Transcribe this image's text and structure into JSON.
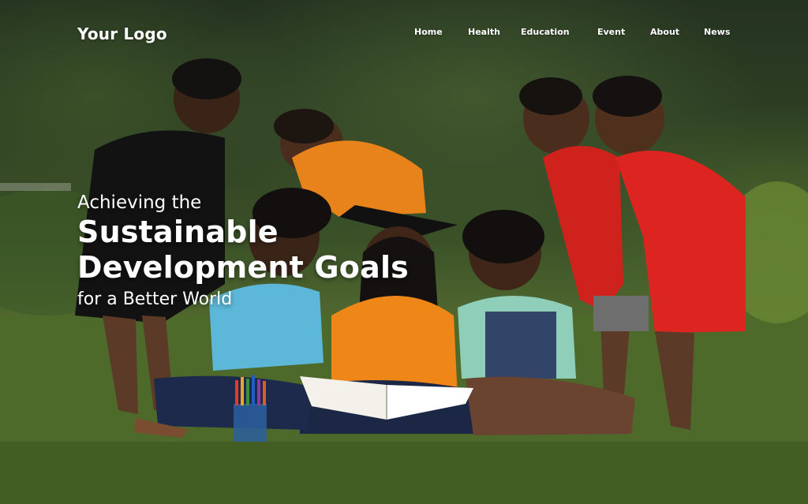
{
  "brand": {
    "logo_text": "Your Logo"
  },
  "nav": {
    "items": [
      {
        "label": "Home"
      },
      {
        "label": "Health"
      },
      {
        "label": "Education"
      },
      {
        "label": "Event"
      },
      {
        "label": "About"
      },
      {
        "label": "News"
      }
    ]
  },
  "hero": {
    "headline_pre": "Achieving the",
    "headline_line1": "Sustainable",
    "headline_line2": "Development Goals",
    "headline_post": "for a Better World",
    "image_description_icon": "children-reading-photo"
  },
  "colors": {
    "text": "#ffffff",
    "grass": "#4f6a2b",
    "foliage": "#2f4124",
    "shirt_orange": "#f08a1c",
    "shirt_red": "#d8241f",
    "shirt_blue": "#5fb8d6",
    "shirt_black": "#141414"
  }
}
